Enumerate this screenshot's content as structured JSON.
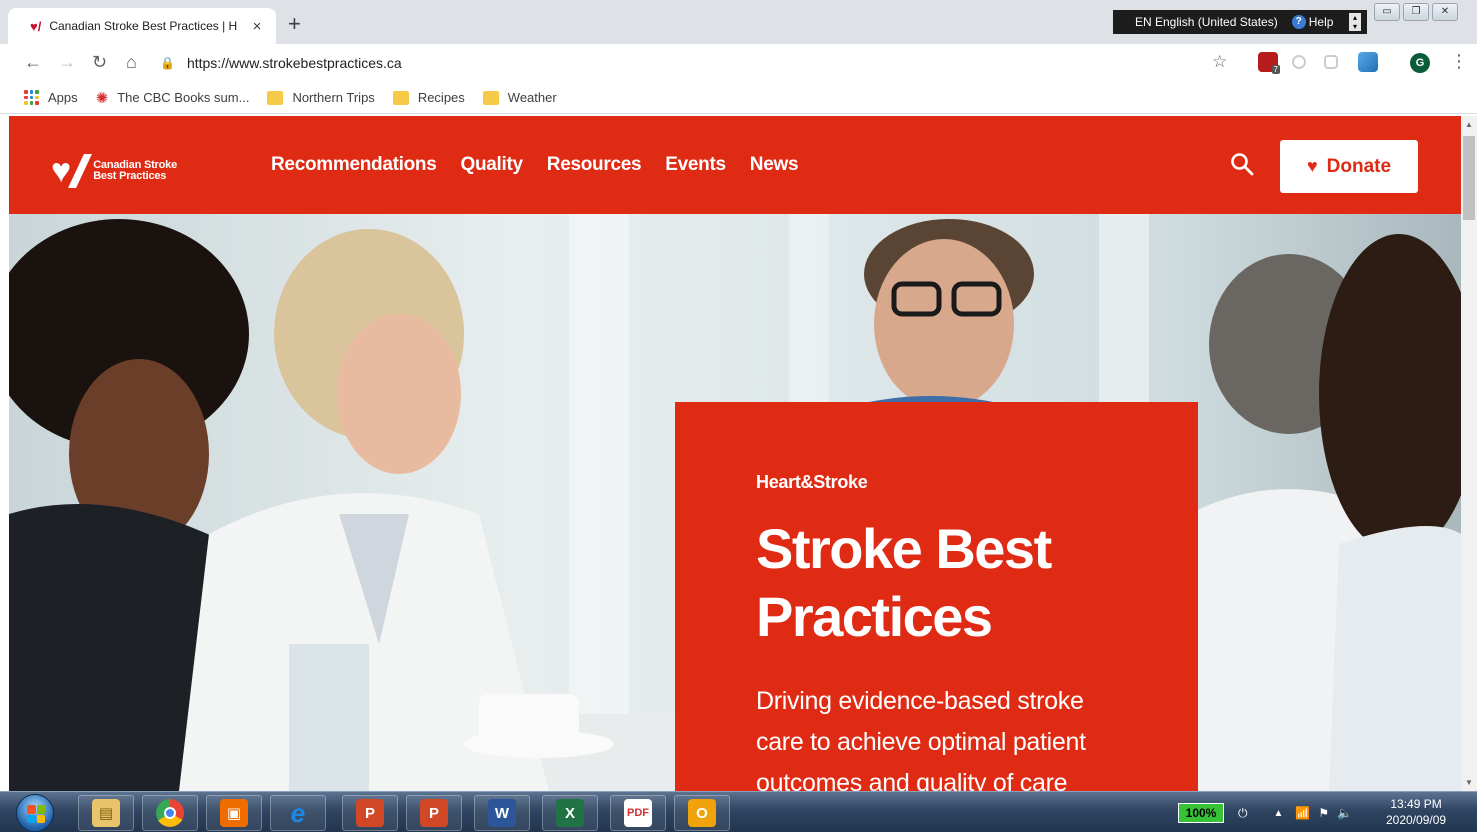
{
  "browser": {
    "tab_title": "Canadian Stroke Best Practices | H",
    "tab_close": "×",
    "new_tab": "+",
    "url": "https://www.strokebestpractices.ca",
    "language_bar": {
      "text": "EN English (United States)",
      "help": "Help"
    },
    "bookmarks": [
      {
        "label": "Apps",
        "icon": "apps-grid-icon"
      },
      {
        "label": "The CBC Books sum...",
        "icon": "cbc-icon"
      },
      {
        "label": "Northern Trips",
        "icon": "folder-icon"
      },
      {
        "label": "Recipes",
        "icon": "folder-icon"
      },
      {
        "label": "Weather",
        "icon": "folder-icon"
      }
    ],
    "profile_initial": "G",
    "extension_badge": "7"
  },
  "site": {
    "logo_text_line1": "Canadian Stroke",
    "logo_text_line2": "Best Practices",
    "nav": [
      "Recommendations",
      "Quality",
      "Resources",
      "Events",
      "News"
    ],
    "donate_label": "Donate",
    "brand_color": "#df2a14"
  },
  "hero": {
    "brand": "Heart&Stroke",
    "title_line1": "Stroke Best",
    "title_line2": "Practices",
    "description": "Driving evidence-based stroke care to achieve optimal patient outcomes and quality of care"
  },
  "taskbar": {
    "apps": [
      "windows-explorer-icon",
      "chrome-icon",
      "media-icon",
      "internet-explorer-icon",
      "powerpoint-icon",
      "powerpoint-icon",
      "word-icon",
      "excel-icon",
      "pdf-icon",
      "outlook-icon"
    ],
    "battery": "100%",
    "time": "13:49 PM",
    "date": "2020/09/09"
  }
}
